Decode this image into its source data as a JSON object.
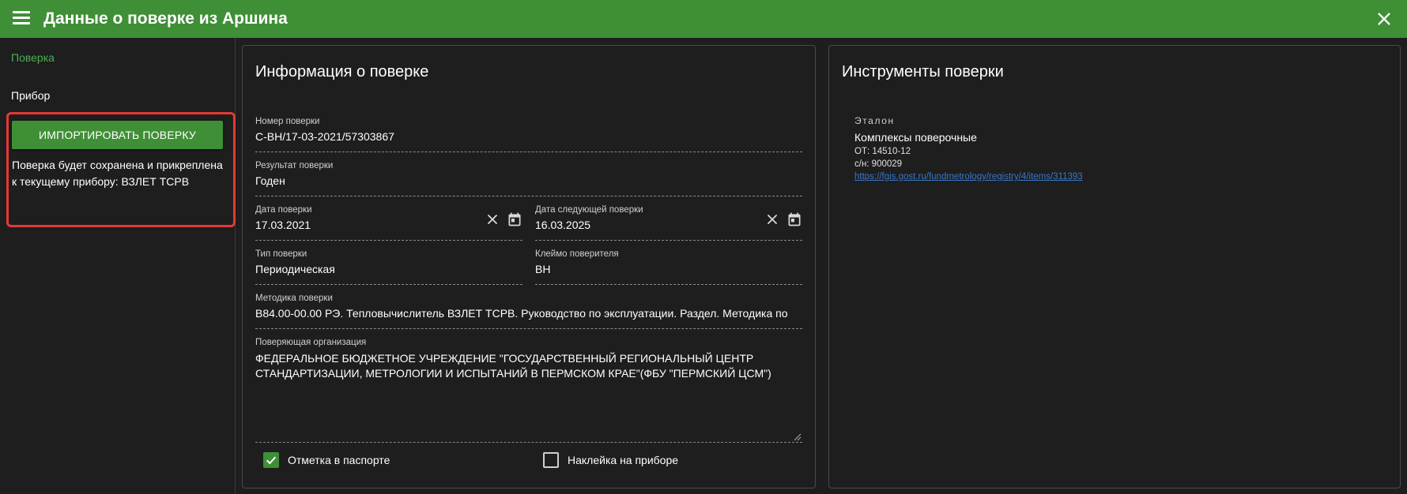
{
  "header": {
    "title": "Данные о поверке из Аршина"
  },
  "sidebar": {
    "items": [
      {
        "label": "Поверка"
      },
      {
        "label": "Прибор"
      }
    ],
    "import_button_label": "ИМПОРТИРОВАТЬ ПОВЕРКУ",
    "import_note": "Поверка будет сохранена и прикреплена к текущему прибору: ВЗЛЕТ ТСРВ"
  },
  "main": {
    "title": "Информация о поверке",
    "fields": {
      "number": {
        "label": "Номер поверки",
        "value": "С-ВН/17-03-2021/57303867"
      },
      "result": {
        "label": "Результат поверки",
        "value": "Годен"
      },
      "date": {
        "label": "Дата поверки",
        "value": "17.03.2021"
      },
      "next_date": {
        "label": "Дата следующей поверки",
        "value": "16.03.2025"
      },
      "type": {
        "label": "Тип поверки",
        "value": "Периодическая"
      },
      "stamp": {
        "label": "Клеймо поверителя",
        "value": "ВН"
      },
      "method": {
        "label": "Методика поверки",
        "value": "В84.00-00.00 РЭ. Тепловычислитель ВЗЛЕТ ТСРВ. Руководство по эксплуатации. Раздел. Методика по"
      },
      "organization": {
        "label": "Поверяющая организация",
        "value": "ФЕДЕРАЛЬНОЕ БЮДЖЕТНОЕ УЧРЕЖДЕНИЕ \"ГОСУДАРСТВЕННЫЙ РЕГИОНАЛЬНЫЙ ЦЕНТР СТАНДАРТИЗАЦИИ, МЕТРОЛОГИИ И ИСПЫТАНИЙ В ПЕРМСКОМ КРАЕ\"(ФБУ \"ПЕРМСКИЙ ЦСМ\")"
      }
    },
    "checkboxes": {
      "passport": {
        "label": "Отметка в паспорте",
        "checked": true
      },
      "sticker": {
        "label": "Наклейка на приборе",
        "checked": false
      }
    }
  },
  "tools": {
    "title": "Инструменты поверки",
    "items": [
      {
        "kind": "Эталон",
        "name": "Комплексы поверочные",
        "ot": "ОТ: 14510-12",
        "sn": "с/н: 900029",
        "link": "https://fgis.gost.ru/fundmetrology/registry/4/items/311393"
      }
    ]
  },
  "colors": {
    "accent": "#3f8f36",
    "active_nav": "#4caf50",
    "highlight": "#e53935",
    "link": "#3b77c4",
    "background": "#1e1e1e"
  },
  "icons": {
    "menu": "menu-icon",
    "close": "close-icon",
    "clear": "clear-icon",
    "calendar": "calendar-icon",
    "checkmark": "checkmark-icon",
    "resize": "resize-handle-icon"
  }
}
